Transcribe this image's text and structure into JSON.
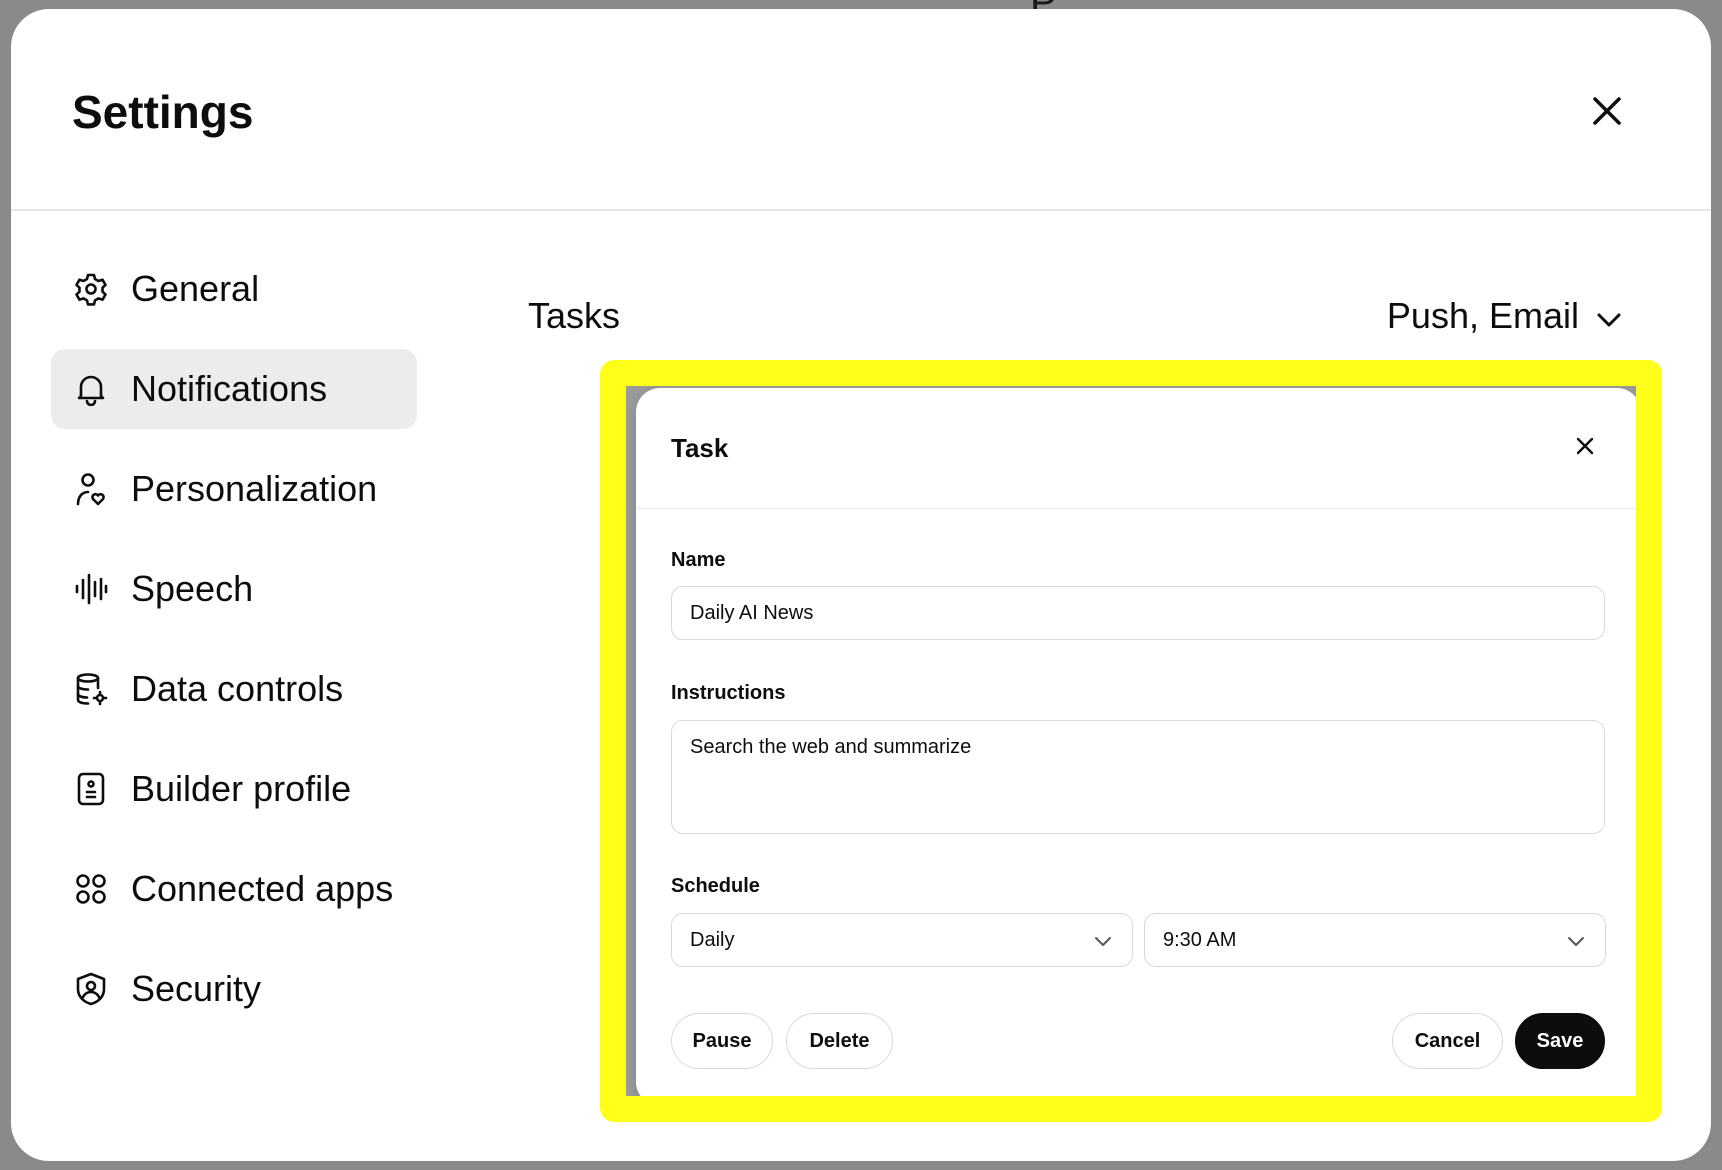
{
  "settings": {
    "title": "Settings",
    "close_icon": "close-icon"
  },
  "sidebar": {
    "items": [
      {
        "label": "General",
        "icon": "gear-icon",
        "active": false
      },
      {
        "label": "Notifications",
        "icon": "bell-icon",
        "active": true
      },
      {
        "label": "Personalization",
        "icon": "person-heart-icon",
        "active": false
      },
      {
        "label": "Speech",
        "icon": "waveform-icon",
        "active": false
      },
      {
        "label": "Data controls",
        "icon": "database-gear-icon",
        "active": false
      },
      {
        "label": "Builder profile",
        "icon": "id-badge-icon",
        "active": false
      },
      {
        "label": "Connected apps",
        "icon": "apps-grid-icon",
        "active": false
      },
      {
        "label": "Security",
        "icon": "shield-user-icon",
        "active": false
      }
    ]
  },
  "notifications": {
    "tasks_label": "Tasks",
    "tasks_value": "Push, Email"
  },
  "task_dialog": {
    "title": "Task",
    "name_label": "Name",
    "name_value": "Daily AI News",
    "instructions_label": "Instructions",
    "instructions_value": "Search the web and summarize",
    "schedule_label": "Schedule",
    "frequency_value": "Daily",
    "time_value": "9:30 AM",
    "pause_label": "Pause",
    "delete_label": "Delete",
    "cancel_label": "Cancel",
    "save_label": "Save"
  },
  "colors": {
    "highlight": "#ffff1a",
    "primary_button": "#0d0d0d",
    "active_sidebar_bg": "#ececec"
  }
}
